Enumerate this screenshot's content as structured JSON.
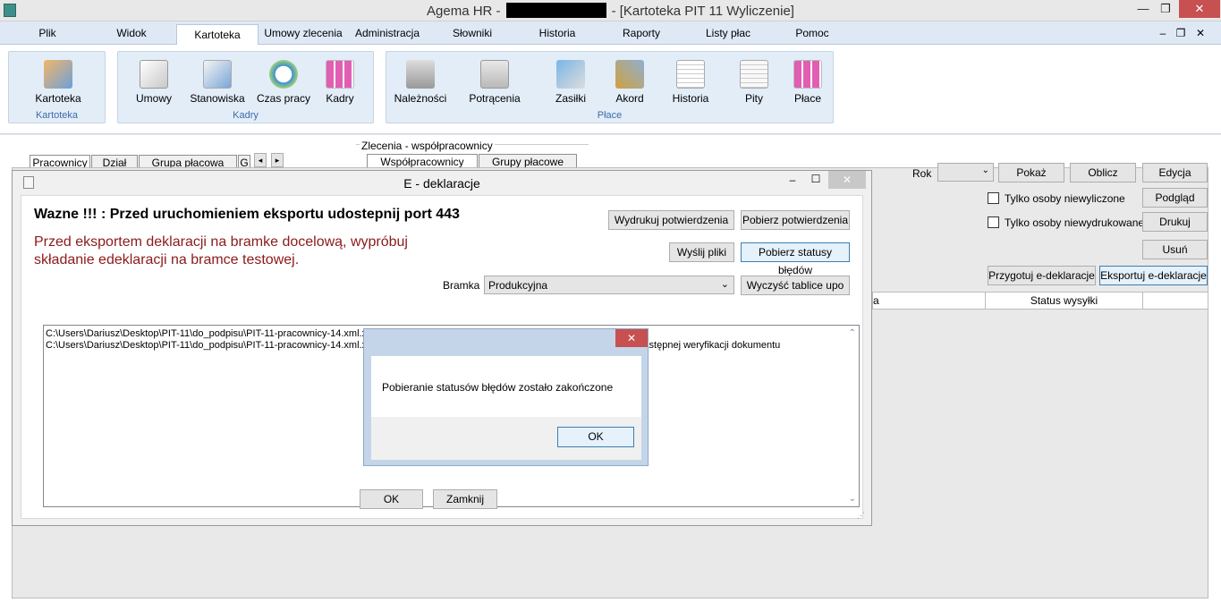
{
  "window": {
    "title_prefix": "Agema HR -",
    "title_suffix": "- [Kartoteka PIT 11 Wyliczenie]",
    "minimize": "—",
    "restore": "❐",
    "close": "✕"
  },
  "menu": [
    "Plik",
    "Widok",
    "Kartoteka",
    "Umowy zlecenia",
    "Administracja",
    "Słowniki",
    "Historia",
    "Raporty",
    "Listy płac",
    "Pomoc"
  ],
  "menu_right": [
    "–",
    "❐",
    "✕"
  ],
  "ribbon": {
    "groups": [
      {
        "label": "Kartoteka",
        "buttons": [
          "Kartoteka"
        ]
      },
      {
        "label": "Kadry",
        "buttons": [
          "Umowy",
          "Stanowiska",
          "Czas pracy",
          "Kadry"
        ]
      },
      {
        "label": "Płace",
        "buttons": [
          "Należności",
          "Potrącenia",
          "Zasiłki",
          "Akord",
          "Historia",
          "Pity",
          "Płace"
        ]
      }
    ]
  },
  "left_tabs": [
    "Pracownicy",
    "Dział",
    "Grupa płacowa",
    "G"
  ],
  "zlecenia": {
    "legend": "Zlecenia - współpracownicy",
    "tabs": [
      "Współpracownicy",
      "Grupy płacowe"
    ]
  },
  "right_panel": {
    "rok_label": "Rok",
    "rok_value": "",
    "pokaz": "Pokaż",
    "oblicz": "Oblicz",
    "edycja": "Edycja",
    "check1": "Tylko osoby niewyliczone",
    "check2": "Tylko osoby niewydrukowane",
    "podglad": "Podgląd",
    "drukuj": "Drukuj",
    "usun": "Usuń",
    "przygotuj": "Przygotuj e-deklaracje",
    "eksportuj": "Eksportuj e-deklaracje",
    "grid_col_partial": "a",
    "grid_col": "Status wysyłki"
  },
  "dialog": {
    "title": "E - deklaracje",
    "heading": "Wazne !!! : Przed uruchomieniem eksportu udostepnij port 443",
    "warning_line1": "Przed eksportem deklaracji na bramke docelową, wypróbuj",
    "warning_line2": "składanie edeklaracji na bramce testowej.",
    "btn_print_conf": "Wydrukuj potwierdzenia",
    "btn_get_conf": "Pobierz potwierdzenia",
    "btn_send": "Wyślij pliki",
    "btn_get_status": "Pobierz statusy błędów",
    "bramka_label": "Bramka",
    "bramka_value": "Produkcyjna",
    "btn_clear": "Wyczyść tablice upo",
    "log": [
      "C:\\Users\\Dariusz\\Desktop\\PIT-11\\do_podpisu\\PIT-11-pracownicy-14.xml.xades: 403: Dokument z niepoprawnym podpisem",
      "C:\\Users\\Dariusz\\Desktop\\PIT-11\\do_podpisu\\PIT-11-pracownicy-14.xml.xades: 301: Dokument w trakcie przetwarzania, sprawdź wynik następnej weryfikacji dokumentu"
    ],
    "ok": "OK",
    "close": "Zamknij"
  },
  "message": {
    "text": "Pobieranie statusów błędów zostało zakończone",
    "ok": "OK",
    "close": "✕"
  },
  "colors": {
    "accent": "#3f6ca8",
    "warning_text": "#8b1a1a",
    "close_red": "#c75050"
  }
}
